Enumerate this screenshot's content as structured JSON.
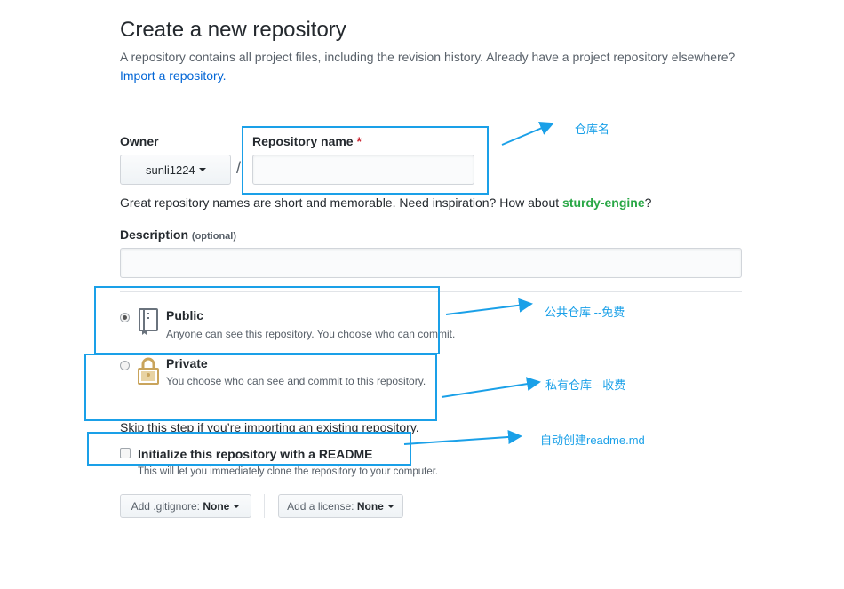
{
  "header": {
    "title": "Create a new repository",
    "subtitle": "A repository contains all project files, including the revision history. Already have a project repository elsewhere?",
    "import_link": "Import a repository."
  },
  "owner": {
    "label": "Owner",
    "value": "sunli1224"
  },
  "separator": "/",
  "repo_name": {
    "label": "Repository name",
    "required_mark": "*",
    "value": "",
    "placeholder": ""
  },
  "hint": {
    "text": "Great repository names are short and memorable. Need inspiration? How about ",
    "suggestion": "sturdy-engine",
    "end": "?"
  },
  "description": {
    "label": "Description",
    "optional": "(optional)",
    "value": ""
  },
  "visibility": {
    "public": {
      "label": "Public",
      "note": "Anyone can see this repository. You choose who can commit.",
      "selected": true
    },
    "private": {
      "label": "Private",
      "note": "You choose who can see and commit to this repository.",
      "selected": false
    }
  },
  "skip_text": "Skip this step if you’re importing an existing repository.",
  "readme": {
    "label": "Initialize this repository with a README",
    "note": "This will let you immediately clone the repository to your computer.",
    "checked": false
  },
  "gitignore": {
    "prefix": "Add .gitignore:",
    "value": "None"
  },
  "license": {
    "prefix": "Add a license:",
    "value": "None"
  },
  "annotations": {
    "repo_name": "仓库名",
    "public": "公共仓库  --免费",
    "private": "私有仓库  --收费",
    "readme": "自动创建readme.md"
  },
  "colors": {
    "annotation": "#1aa0e8",
    "link": "#0366d6",
    "required": "#cb2431",
    "lock": "#c9a45c"
  },
  "icons": {
    "public": "repo-book-icon",
    "private": "lock-icon"
  }
}
